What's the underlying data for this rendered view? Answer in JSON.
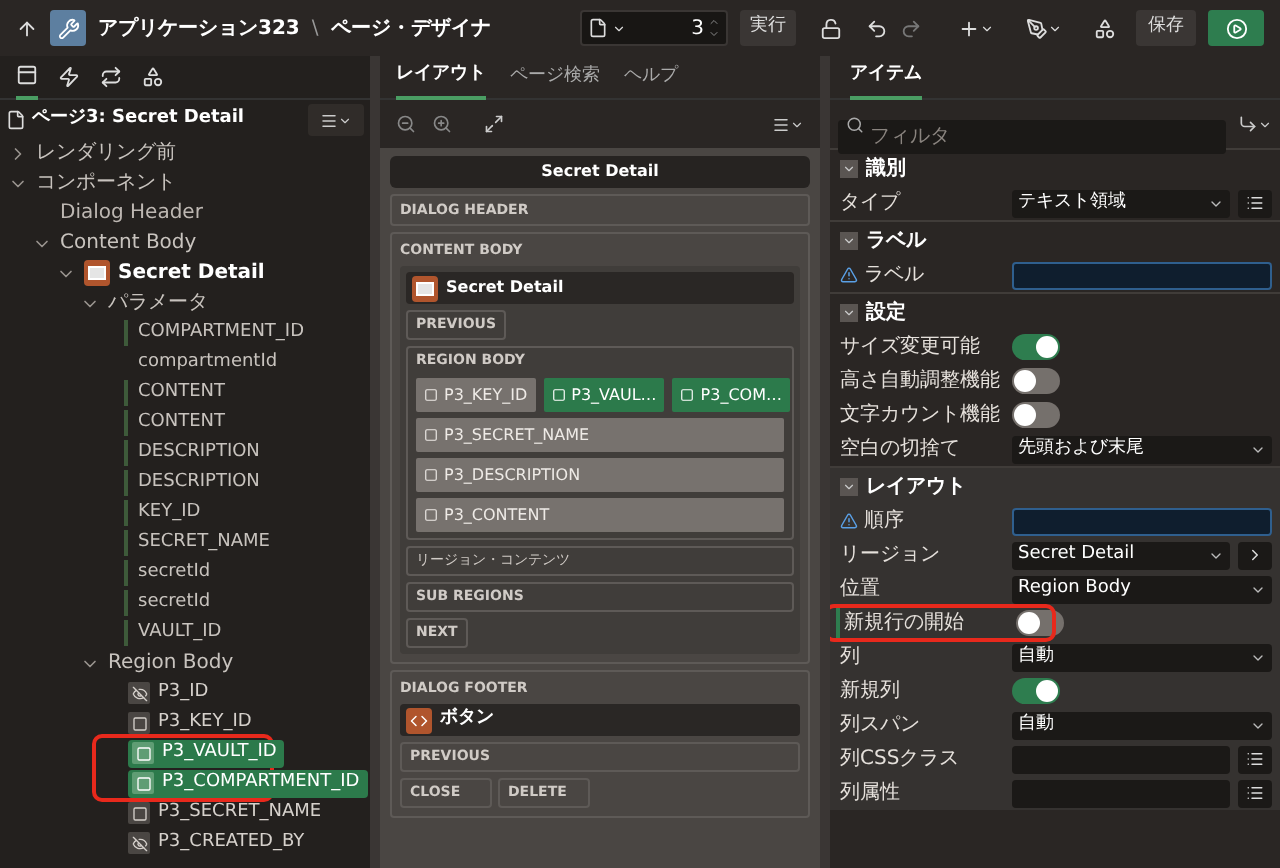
{
  "topbar": {
    "app": "アプリケーション323",
    "separator": "\\",
    "page_title": "ページ・デザイナ",
    "page_number": "3",
    "run_button": "実行",
    "save_button": "保存"
  },
  "left": {
    "tabs": [
      {
        "kind": "rendering",
        "selected": true
      },
      {
        "kind": "dynamic",
        "selected": false
      },
      {
        "kind": "processing",
        "selected": false
      },
      {
        "kind": "shared",
        "selected": false
      }
    ],
    "page_label": "ページ3: Secret Detail",
    "tree": [
      {
        "kind": "folder",
        "label": "レンダリング前",
        "expanded": false
      },
      {
        "kind": "folder",
        "label": "コンポーネント",
        "expanded": true,
        "children": [
          {
            "kind": "leaf",
            "label": "Dialog Header"
          },
          {
            "kind": "folder",
            "label": "Content Body",
            "expanded": true,
            "children": [
              {
                "kind": "region",
                "label": "Secret Detail",
                "expanded": true,
                "children": [
                  {
                    "kind": "folder",
                    "label": "パラメータ",
                    "expanded": true,
                    "children": [
                      {
                        "kind": "param",
                        "label": "COMPARTMENT_ID",
                        "flagged": true
                      },
                      {
                        "kind": "param",
                        "label": "compartmentId"
                      },
                      {
                        "kind": "param",
                        "label": "CONTENT",
                        "flagged": true
                      },
                      {
                        "kind": "param",
                        "label": "CONTENT",
                        "flagged": true
                      },
                      {
                        "kind": "param",
                        "label": "DESCRIPTION",
                        "flagged": true
                      },
                      {
                        "kind": "param",
                        "label": "DESCRIPTION",
                        "flagged": true
                      },
                      {
                        "kind": "param",
                        "label": "KEY_ID",
                        "flagged": true
                      },
                      {
                        "kind": "param",
                        "label": "SECRET_NAME",
                        "flagged": true
                      },
                      {
                        "kind": "param",
                        "label": "secretId",
                        "flagged": true
                      },
                      {
                        "kind": "param",
                        "label": "secretId",
                        "flagged": true
                      },
                      {
                        "kind": "param",
                        "label": "VAULT_ID",
                        "flagged": true
                      }
                    ]
                  },
                  {
                    "kind": "folder",
                    "label": "Region Body",
                    "expanded": true,
                    "children": [
                      {
                        "kind": "hidden_item",
                        "label": "P3_ID",
                        "selected": false
                      },
                      {
                        "kind": "text_item",
                        "label": "P3_KEY_ID",
                        "selected": false
                      },
                      {
                        "kind": "text_item",
                        "label": "P3_VAULT_ID",
                        "selected": true,
                        "annotated": true
                      },
                      {
                        "kind": "text_item",
                        "label": "P3_COMPARTMENT_ID",
                        "selected": true,
                        "annotated": true
                      },
                      {
                        "kind": "text_item",
                        "label": "P3_SECRET_NAME",
                        "selected": false
                      },
                      {
                        "kind": "hidden_item",
                        "label": "P3_CREATED_BY",
                        "selected": false
                      }
                    ]
                  }
                ]
              }
            ]
          }
        ]
      }
    ]
  },
  "middle": {
    "tabs": [
      {
        "label": "レイアウト",
        "selected": true
      },
      {
        "label": "ページ検索",
        "selected": false
      },
      {
        "label": "ヘルプ",
        "selected": false
      }
    ],
    "canvas": {
      "title": "Secret Detail",
      "dialog_header": "DIALOG HEADER",
      "content_body": "CONTENT BODY",
      "region": {
        "title": "Secret Detail",
        "previous": "PREVIOUS",
        "region_body": "REGION BODY",
        "item_rows": [
          [
            {
              "label": "P3_KEY_ID",
              "selected": false
            },
            {
              "label": "P3_VAUL…",
              "selected": true
            },
            {
              "label": "P3_COM…",
              "selected": true
            }
          ],
          [
            {
              "label": "P3_SECRET_NAME",
              "selected": false
            }
          ],
          [
            {
              "label": "P3_DESCRIPTION",
              "selected": false
            }
          ],
          [
            {
              "label": "P3_CONTENT",
              "selected": false
            }
          ]
        ],
        "region_content": "リージョン・コンテンツ",
        "sub_regions": "SUB REGIONS",
        "next": "NEXT"
      },
      "dialog_footer": "DIALOG FOOTER",
      "footer_region": {
        "title": "ボタン",
        "previous": "PREVIOUS",
        "buttons": [
          "CLOSE",
          "DELETE"
        ]
      }
    }
  },
  "right": {
    "tab": "アイテム",
    "filter_placeholder": "フィルタ",
    "groups": [
      {
        "title": "識別",
        "rows": [
          {
            "kind": "select",
            "label": "タイプ",
            "value": "テキスト領域",
            "side_button": true
          }
        ]
      },
      {
        "title": "ラベル",
        "rows": [
          {
            "kind": "input",
            "label": "ラベル",
            "required": true
          }
        ]
      },
      {
        "title": "設定",
        "rows": [
          {
            "kind": "switch",
            "label": "サイズ変更可能",
            "on": true
          },
          {
            "kind": "switch",
            "label": "高さ自動調整機能",
            "on": false
          },
          {
            "kind": "switch",
            "label": "文字カウント機能",
            "on": false
          },
          {
            "kind": "select",
            "label": "空白の切捨て",
            "value": "先頭および末尾"
          }
        ]
      },
      {
        "title": "レイアウト",
        "rows": [
          {
            "kind": "input",
            "label": "順序",
            "required": true
          },
          {
            "kind": "select",
            "label": "リージョン",
            "value": "Secret Detail",
            "side_button": true
          },
          {
            "kind": "select",
            "label": "位置",
            "value": "Region Body"
          },
          {
            "kind": "switch",
            "label": "新規行の開始",
            "on": false,
            "annotated": true
          },
          {
            "kind": "select",
            "label": "列",
            "value": "自動"
          },
          {
            "kind": "switch",
            "label": "新規列",
            "on": true
          },
          {
            "kind": "select",
            "label": "列スパン",
            "value": "自動"
          },
          {
            "kind": "input",
            "label": "列CSSクラス",
            "required": false,
            "side_button": true
          },
          {
            "kind": "input",
            "label": "列属性",
            "required": false,
            "side_button": true
          }
        ]
      }
    ]
  }
}
